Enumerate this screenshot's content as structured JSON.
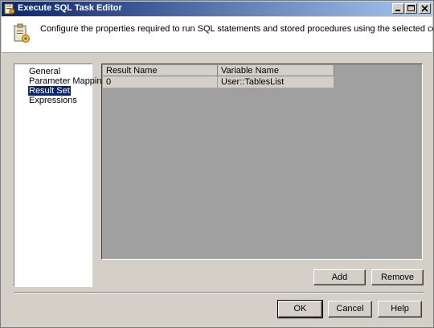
{
  "window": {
    "title": "Execute SQL Task Editor"
  },
  "header": {
    "description": "Configure the properties required to run SQL statements and stored procedures using the selected connection."
  },
  "nav": {
    "items": [
      {
        "label": "General"
      },
      {
        "label": "Parameter Mapping"
      },
      {
        "label": "Result Set"
      },
      {
        "label": "Expressions"
      }
    ],
    "selected": "Result Set"
  },
  "grid": {
    "columns": [
      "Result Name",
      "Variable Name"
    ],
    "rows": [
      [
        "0",
        "User::TablesList"
      ]
    ]
  },
  "buttons": {
    "add": "Add",
    "remove": "Remove",
    "ok": "OK",
    "cancel": "Cancel",
    "help": "Help"
  },
  "icons": {
    "app": "sql-task-icon",
    "header": "clipboard-gear-icon"
  },
  "colors": {
    "title_bar_start": "#0a246a",
    "title_bar_end": "#a6caf0",
    "selection": "#0a246a",
    "dialog_face": "#d4d0c8",
    "grid_background": "#a0a0a0"
  }
}
